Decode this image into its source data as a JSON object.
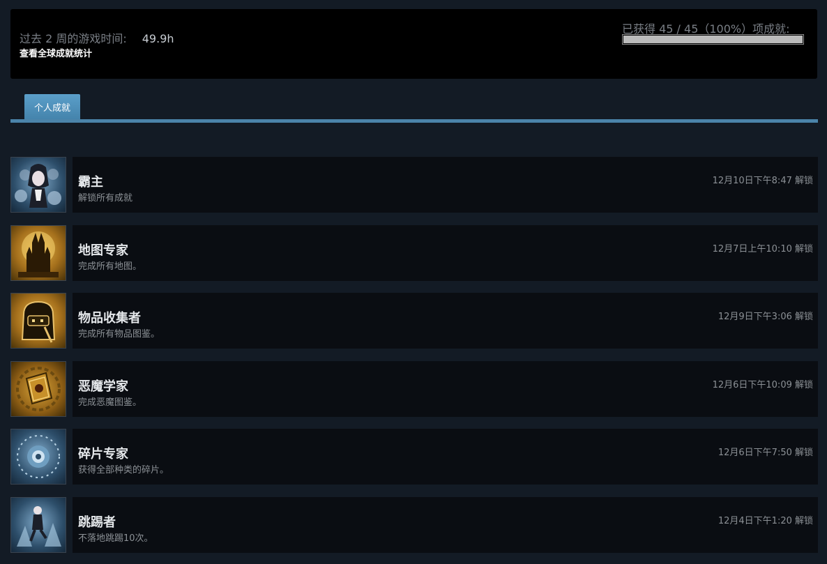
{
  "summary": {
    "playtime_label": "过去 2 周的游戏时间:",
    "playtime_value": "49.9h",
    "global_link": "查看全球成就统计",
    "progress_label": "已获得 45 / 45（100%）项成就:",
    "progress_fraction": 1.0
  },
  "tabs": {
    "personal": "个人成就"
  },
  "achievements": [
    {
      "title": "霸主",
      "desc": "解锁所有成就",
      "time": "12月10日下午8:47 解锁",
      "icon": "girl-portrait-icon"
    },
    {
      "title": "地图专家",
      "desc": "完成所有地图。",
      "time": "12月7日上午10:10 解锁",
      "icon": "castle-icon"
    },
    {
      "title": "物品收集者",
      "desc": "完成所有物品图鉴。",
      "time": "12月9日下午3:06 解锁",
      "icon": "backpack-icon"
    },
    {
      "title": "恶魔学家",
      "desc": "完成恶魔图鉴。",
      "time": "12月6日下午10:09 解锁",
      "icon": "book-icon"
    },
    {
      "title": "碎片专家",
      "desc": "获得全部种类的碎片。",
      "time": "12月6日下午7:50 解锁",
      "icon": "shard-flower-icon"
    },
    {
      "title": "跳踢者",
      "desc": "不落地跳踢10次。",
      "time": "12月4日下午1:20 解锁",
      "icon": "jump-kick-icon"
    }
  ],
  "colors": {
    "accent": "#4b84aa",
    "background": "#131b25",
    "panel": "#000000"
  }
}
